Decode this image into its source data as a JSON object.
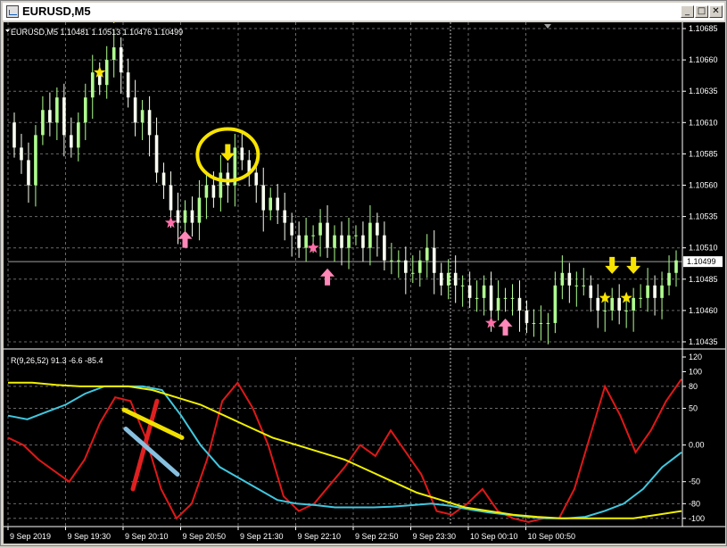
{
  "window": {
    "title": "EURUSD,M5",
    "minimize_icon": "minimize-icon",
    "maximize_icon": "maximize-icon",
    "close_icon": "close-icon",
    "minimize_glyph": "_",
    "maximize_glyph": "□",
    "close_glyph": "✕"
  },
  "colors": {
    "background": "#000000",
    "grid": "#6a6a6a",
    "bull_candle": "#b0ff90",
    "bear_candle": "#f8fff0",
    "cyan_line": "#40c8e0",
    "red_line": "#e01818",
    "yellow_line": "#f0f000",
    "arrow_yellow": "#f8e400",
    "arrow_pink": "#ff88b8",
    "star_yellow": "#f8e400",
    "star_pink": "#ff6fa8",
    "axis_text": "#ffffff"
  },
  "main_chart": {
    "info": "EURUSD,M5  1.10481 1.10513 1.10476 1.10499",
    "current_price": "1.10499",
    "price_ticks": [
      "1.10685",
      "1.10660",
      "1.10635",
      "1.10610",
      "1.10585",
      "1.10560",
      "1.10535",
      "1.10510",
      "1.10485",
      "1.10460",
      "1.10435"
    ],
    "time_ticks": [
      "9 Sep 2019",
      "9 Sep 19:30",
      "9 Sep 20:10",
      "9 Sep 20:50",
      "9 Sep 21:30",
      "9 Sep 22:10",
      "9 Sep 22:50",
      "9 Sep 23:30",
      "10 Sep 00:10",
      "10 Sep 00:50"
    ]
  },
  "indicator": {
    "label": "R(9,26,52) 91.3 -6.6 -85.4",
    "ticks": [
      "120",
      "100",
      "80",
      "50",
      "0.00",
      "-50",
      "-80",
      "-100"
    ]
  },
  "chart_data": [
    {
      "type": "candlestick",
      "title": "EURUSD,M5",
      "ylim": [
        1.1043,
        1.1069
      ],
      "closes": [
        1.1059,
        1.1058,
        1.1056,
        1.106,
        1.1062,
        1.1061,
        1.1063,
        1.106,
        1.1059,
        1.1061,
        1.1063,
        1.1065,
        1.1064,
        1.1066,
        1.1067,
        1.1065,
        1.1063,
        1.1061,
        1.1062,
        1.106,
        1.1057,
        1.1056,
        1.1054,
        1.1053,
        1.1054,
        1.1053,
        1.1055,
        1.1056,
        1.1055,
        1.1057,
        1.1056,
        1.1059,
        1.1058,
        1.1057,
        1.1056,
        1.1054,
        1.1055,
        1.1054,
        1.1053,
        1.1052,
        1.1051,
        1.1052,
        1.1052,
        1.1053,
        1.1051,
        1.1052,
        1.1051,
        1.1052,
        1.1052,
        1.1051,
        1.1053,
        1.1052,
        1.105,
        1.105,
        1.105,
        1.1049,
        1.1049,
        1.105,
        1.1051,
        1.1049,
        1.1048,
        1.1049,
        1.1048,
        1.1048,
        1.1047,
        1.1047,
        1.1048,
        1.1046,
        1.1047,
        1.1047,
        1.1047,
        1.1046,
        1.1045,
        1.1045,
        1.1045,
        1.1045,
        1.1048,
        1.1049,
        1.1048,
        1.1048,
        1.1048,
        1.1047,
        1.1046,
        1.1046,
        1.1047,
        1.1046,
        1.1046,
        1.1047,
        1.1047,
        1.1048,
        1.1047,
        1.1048,
        1.1049,
        1.105
      ],
      "signals": [
        {
          "kind": "down-arrow",
          "color": "yellow",
          "candle": 14
        },
        {
          "kind": "star",
          "color": "yellow",
          "candle": 12
        },
        {
          "kind": "down-arrow",
          "color": "yellow",
          "candle": 30,
          "circled": true
        },
        {
          "kind": "star",
          "color": "pink",
          "candle": 22
        },
        {
          "kind": "up-arrow",
          "color": "pink",
          "candle": 24
        },
        {
          "kind": "star",
          "color": "pink",
          "candle": 42
        },
        {
          "kind": "up-arrow",
          "color": "pink",
          "candle": 44
        },
        {
          "kind": "star",
          "color": "pink",
          "candle": 67
        },
        {
          "kind": "up-arrow",
          "color": "pink",
          "candle": 69
        },
        {
          "kind": "down-arrow",
          "color": "yellow",
          "candle": 84
        },
        {
          "kind": "down-arrow",
          "color": "yellow",
          "candle": 87
        },
        {
          "kind": "star",
          "color": "yellow",
          "candle": 83
        },
        {
          "kind": "star",
          "color": "yellow",
          "candle": 86
        }
      ]
    },
    {
      "type": "line",
      "title": "R(9,26,52) 91.3 -6.6 -85.4",
      "ylim": [
        -110,
        120
      ],
      "series": [
        {
          "color": "red",
          "values": [
            10,
            0,
            -20,
            -35,
            -50,
            -20,
            30,
            65,
            60,
            10,
            -60,
            -100,
            -80,
            -20,
            60,
            85,
            50,
            0,
            -70,
            -90,
            -80,
            -55,
            -30,
            0,
            -15,
            20,
            -10,
            -40,
            -90,
            -95,
            -80,
            -60,
            -90,
            -100,
            -105,
            -100,
            -100,
            -60,
            10,
            80,
            40,
            -10,
            20,
            60,
            90
          ]
        },
        {
          "color": "cyan",
          "values": [
            40,
            35,
            45,
            55,
            70,
            80,
            80,
            80,
            75,
            40,
            0,
            -30,
            -45,
            -60,
            -75,
            -80,
            -82,
            -85,
            -85,
            -85,
            -84,
            -82,
            -80,
            -83,
            -88,
            -92,
            -95,
            -98,
            -100,
            -100,
            -98,
            -90,
            -80,
            -60,
            -30,
            -10
          ]
        },
        {
          "color": "yellow",
          "values": [
            85,
            85,
            82,
            80,
            80,
            80,
            75,
            65,
            55,
            40,
            25,
            10,
            0,
            -10,
            -20,
            -35,
            -50,
            -65,
            -75,
            -85,
            -90,
            -95,
            -98,
            -100,
            -100,
            -100,
            -100,
            -95,
            -90
          ]
        }
      ]
    }
  ]
}
